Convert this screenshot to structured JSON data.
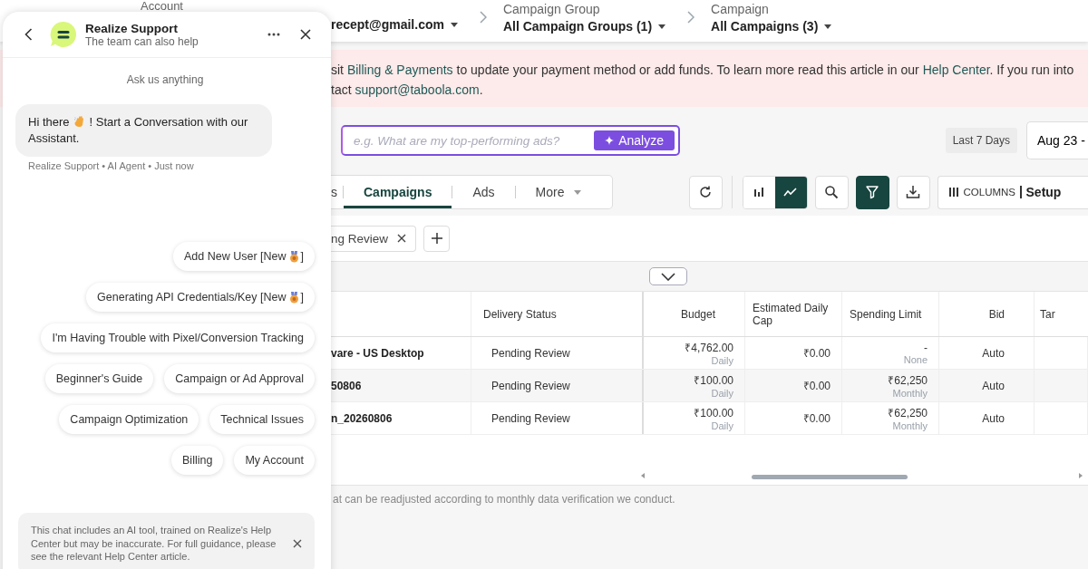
{
  "header": {
    "account": {
      "label": "Account",
      "value": "recept@gmail.com"
    },
    "crumbs": [
      {
        "label": "Campaign Group",
        "value": "All Campaign Groups (1)"
      },
      {
        "label": "Campaign",
        "value": "All Campaigns (3)"
      }
    ]
  },
  "alert": {
    "lines": [
      [
        {
          "kind": "text",
          "text": "sit "
        },
        {
          "kind": "link",
          "text": "Billing & Payments"
        },
        {
          "kind": "text",
          "text": " to update your payment method or add funds. To learn more read this article in our "
        },
        {
          "kind": "link",
          "text": "Help Center"
        },
        {
          "kind": "text",
          "text": ". If you run into"
        }
      ],
      [
        {
          "kind": "text",
          "text": "tact "
        },
        {
          "kind": "link",
          "text": "support@taboola.com"
        },
        {
          "kind": "text",
          "text": "."
        }
      ]
    ]
  },
  "analyze": {
    "placeholder": "e.g. What are my top-performing ads?",
    "button": "Analyze"
  },
  "date_range": {
    "preset": "Last 7 Days",
    "value": "Aug 23 -"
  },
  "tabs": [
    {
      "label": "s",
      "selected": false
    },
    {
      "label": "Campaigns",
      "selected": true
    },
    {
      "label": "Ads",
      "selected": false
    },
    {
      "label": "More",
      "selected": false
    }
  ],
  "view_toggle": [
    {
      "kind": "bar",
      "selected": false
    },
    {
      "kind": "line",
      "selected": true
    }
  ],
  "filter": {
    "active": true
  },
  "columns_button": {
    "label": "COLUMNS",
    "value": "Setup"
  },
  "filter_chip": {
    "label": "ng Review"
  },
  "table": {
    "columns": [
      "",
      "Delivery Status",
      "Budget",
      "Estimated Daily Cap",
      "Spending Limit",
      "Bid",
      "Tar"
    ],
    "rows": [
      {
        "name": "vare - US Desktop",
        "status": "Pending Review",
        "budget": "₹4,762.00",
        "budget_period": "Daily",
        "cap": "₹0.00",
        "limit": "-",
        "limit_period": "None",
        "bid": "Auto"
      },
      {
        "name": "50806",
        "status": "Pending Review",
        "budget": "₹100.00",
        "budget_period": "Daily",
        "cap": "₹0.00",
        "limit": "₹62,250",
        "limit_period": "Monthly",
        "bid": "Auto"
      },
      {
        "name": "n_20260806",
        "status": "Pending Review",
        "budget": "₹100.00",
        "budget_period": "Daily",
        "cap": "₹0.00",
        "limit": "₹62,250",
        "limit_period": "Monthly",
        "bid": "Auto"
      }
    ]
  },
  "footnote": "at can be readjusted according to monthly data verification we conduct.",
  "chat": {
    "title": "Realize Support",
    "subtitle": "The team can also help",
    "intro": "Ask us anything",
    "greeting": {
      "before": "Hi there",
      "after": "! Start a Conversation with our",
      "rest": "Assistant."
    },
    "meta": "Realize Support • AI Agent • Just now",
    "suggestions": [
      {
        "label": "Add New User [New",
        "suffix": "]",
        "kind": "new"
      },
      {
        "label": "Generating API Credentials/Key [New",
        "suffix": "]",
        "kind": "new"
      },
      {
        "label": "I'm Having Trouble with Pixel/Conversion Tracking",
        "kind": "plain"
      },
      {
        "label": "Beginner's Guide",
        "kind": "plain"
      },
      {
        "label": "Campaign or Ad Approval",
        "kind": "plain"
      },
      {
        "label": "Campaign Optimization",
        "kind": "plain"
      },
      {
        "label": "Technical Issues",
        "kind": "plain"
      },
      {
        "label": "Billing",
        "kind": "plain"
      },
      {
        "label": "My Account",
        "kind": "plain"
      }
    ],
    "disclaimer": "This chat includes an AI tool, trained on Realize's Help Center but may be inaccurate. For full guidance, please see the relevant Help Center article."
  }
}
